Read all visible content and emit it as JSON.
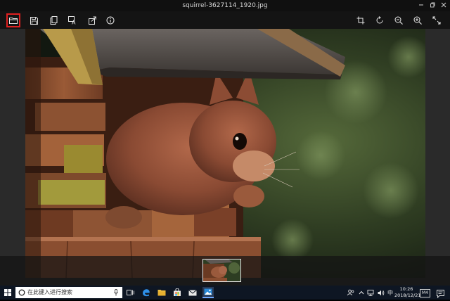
{
  "window": {
    "title": "squirrel-3627114_1920.jpg",
    "controls": [
      "minimize-icon",
      "restore-icon",
      "close-icon"
    ]
  },
  "toolbar": {
    "left_tools": [
      "folder-open-icon",
      "save-icon",
      "copy-icon",
      "text-recognition-icon",
      "share-icon",
      "info-icon"
    ],
    "right_tools": [
      "crop-icon",
      "rotate-icon",
      "zoom-out-icon",
      "zoom-in-icon",
      "fullscreen-icon"
    ],
    "selected_tool": "folder-open-icon",
    "selected_color": "#e02020"
  },
  "viewer": {
    "background": "#2a2a2a",
    "image_name": "squirrel-3627114_1920.jpg"
  },
  "filmstrip": {
    "selected_index": 0,
    "thumbnail_count": 1
  },
  "taskbar": {
    "search_placeholder": "在此键入进行搜索",
    "pinned_apps": [
      "task-view-icon",
      "edge-icon",
      "file-explorer-icon",
      "store-icon",
      "mail-icon",
      "photos-icon"
    ],
    "active_app": "photos-icon",
    "tray": {
      "ime_label": "中",
      "badge_label": "M4",
      "time": "10:26",
      "date": "2018/12/21"
    }
  }
}
